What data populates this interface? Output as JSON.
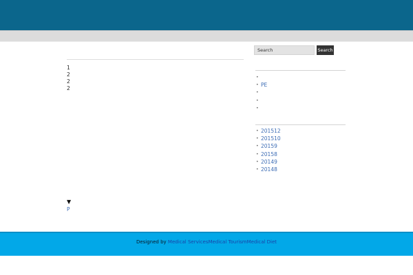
{
  "main": {
    "list_values": [
      "1",
      "2",
      "2",
      "2"
    ],
    "expand_symbol": "▼",
    "post_link": "P"
  },
  "sidebar": {
    "search": {
      "placeholder": "Search",
      "button_label": "Search"
    },
    "recent_posts": [
      "",
      "PE",
      "",
      "",
      ""
    ],
    "archives": [
      "201512",
      "201510",
      "20159",
      "20158",
      "20149",
      "20148"
    ]
  },
  "footer": {
    "designed_by": "Designed by ",
    "link_1": "Medical Services",
    "link_2": "Medical Tourism",
    "link_3": "Medical Diet"
  },
  "colors": {
    "header": "#0b668c",
    "nav": "#dcdcdc",
    "footer": "#02a8e8",
    "link": "#3d6db5",
    "search_button": "#333333"
  },
  "icons": {
    "bullet": "bullet-icon",
    "expand": "triangle-down-icon"
  }
}
